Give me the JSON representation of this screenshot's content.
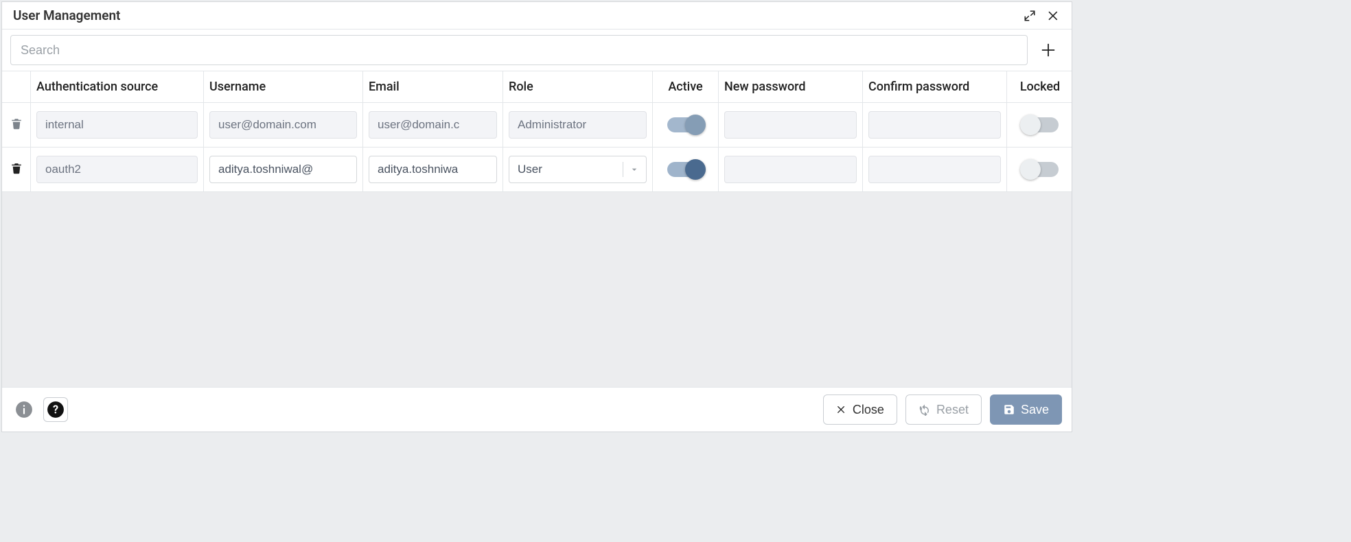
{
  "dialog": {
    "title": "User Management"
  },
  "search": {
    "placeholder": "Search",
    "value": ""
  },
  "columns": {
    "auth": "Authentication source",
    "username": "Username",
    "email": "Email",
    "role": "Role",
    "active": "Active",
    "newpw": "New password",
    "confpw": "Confirm password",
    "locked": "Locked"
  },
  "rows": [
    {
      "deletable": false,
      "auth_source": "internal",
      "auth_readonly": true,
      "username": "user@domain.com",
      "username_readonly": true,
      "email": "user@domain.c",
      "email_readonly": true,
      "role": "Administrator",
      "role_readonly": true,
      "active": true,
      "active_disabled": true,
      "new_password": "",
      "confirm_password": "",
      "locked": false
    },
    {
      "deletable": true,
      "auth_source": "oauth2",
      "auth_readonly": true,
      "username": "aditya.toshniwal@",
      "username_readonly": false,
      "email": "aditya.toshniwa",
      "email_readonly": false,
      "role": "User",
      "role_readonly": false,
      "active": true,
      "active_disabled": false,
      "new_password": "",
      "confirm_password": "",
      "locked": false
    }
  ],
  "footer": {
    "close": "Close",
    "reset": "Reset",
    "save": "Save"
  },
  "colors": {
    "accent": "#4a6a8f"
  }
}
